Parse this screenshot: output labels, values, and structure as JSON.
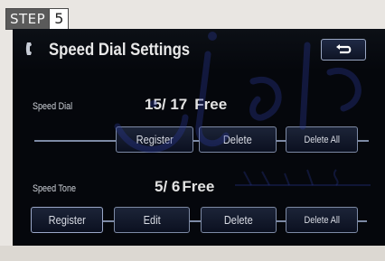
{
  "step": {
    "label": "STEP",
    "number": "5"
  },
  "screen": {
    "title": "Speed Dial Settings",
    "back_icon": "return-arrow-icon",
    "phone_icon": "phone-handset-icon"
  },
  "speed_dial": {
    "label": "Speed Dial",
    "count": "15/ 17",
    "free_label": "Free",
    "buttons": {
      "register": "Register",
      "delete": "Delete",
      "delete_all": "Delete All"
    }
  },
  "speed_tone": {
    "label": "Speed Tone",
    "count": "5/ 6",
    "free_label": "Free",
    "buttons": {
      "register": "Register",
      "edit": "Edit",
      "delete": "Delete",
      "delete_all": "Delete All"
    }
  },
  "colors": {
    "screen_bg": "#05070c",
    "button_border": "#7d8aa5",
    "text": "#e2e2e2"
  }
}
